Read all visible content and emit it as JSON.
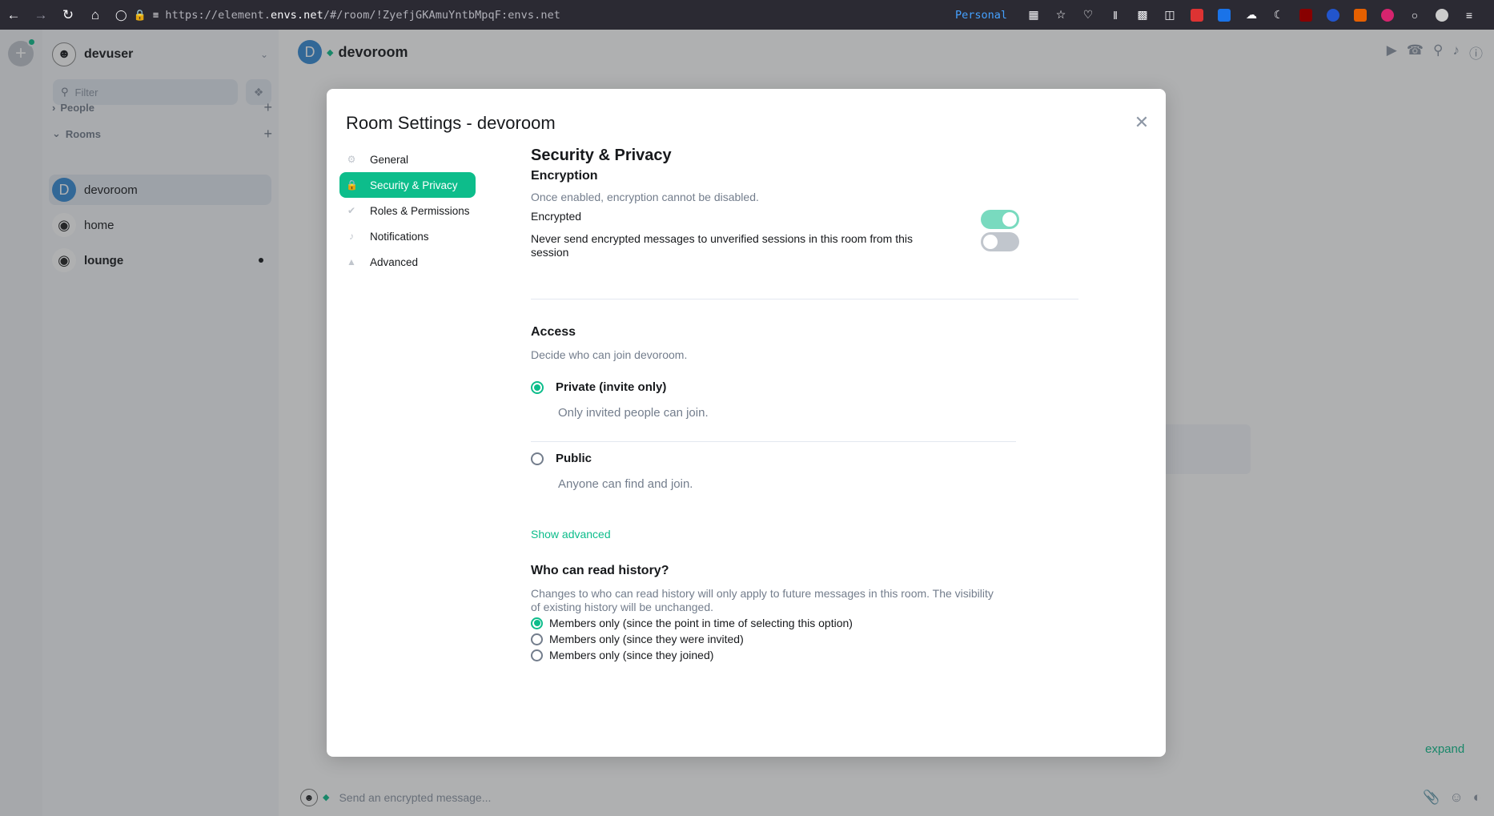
{
  "browser": {
    "url_prefix": "https://element.",
    "url_domain": "envs.net",
    "url_suffix": "/#/room/!ZyefjGKAmuYntbMpqF:envs.net",
    "container": "Personal"
  },
  "app": {
    "user": {
      "name": "devuser"
    },
    "filter_placeholder": "Filter",
    "sections": {
      "people": "People",
      "rooms": "Rooms"
    },
    "rooms": [
      {
        "name": "devoroom",
        "initial": "D",
        "color": "#368bd6"
      },
      {
        "name": "home"
      },
      {
        "name": "lounge"
      }
    ],
    "header": {
      "title": "devoroom",
      "initial": "D"
    },
    "expand": "expand",
    "composer_placeholder": "Send an encrypted message..."
  },
  "dialog": {
    "title": "Room Settings - devoroom",
    "tabs": [
      {
        "label": "General",
        "icon": "gear-icon"
      },
      {
        "label": "Security & Privacy",
        "icon": "lock-icon"
      },
      {
        "label": "Roles & Permissions",
        "icon": "badge-icon"
      },
      {
        "label": "Notifications",
        "icon": "bell-icon"
      },
      {
        "label": "Advanced",
        "icon": "warning-icon"
      }
    ],
    "section_title": "Security & Privacy",
    "encryption": {
      "heading": "Encryption",
      "description": "Once enabled, encryption cannot be disabled.",
      "encrypted_label": "Encrypted",
      "encrypted_on": true,
      "never_send_label": "Never send encrypted messages to unverified sessions in this room from this session",
      "never_send_on": false
    },
    "access": {
      "heading": "Access",
      "description": "Decide who can join devoroom.",
      "options": [
        {
          "label": "Private (invite only)",
          "desc": "Only invited people can join.",
          "selected": true
        },
        {
          "label": "Public",
          "desc": "Anyone can find and join.",
          "selected": false
        }
      ],
      "show_advanced": "Show advanced"
    },
    "history": {
      "heading": "Who can read history?",
      "description": "Changes to who can read history will only apply to future messages in this room. The visibility of existing history will be unchanged.",
      "options": [
        {
          "label": "Members only (since the point in time of selecting this option)",
          "selected": true
        },
        {
          "label": "Members only (since they were invited)",
          "selected": false
        },
        {
          "label": "Members only (since they joined)",
          "selected": false
        }
      ]
    }
  },
  "colors": {
    "accent": "#0dbd8b",
    "browser_bg": "#2b2a33",
    "link_blue": "#45a1ff"
  }
}
